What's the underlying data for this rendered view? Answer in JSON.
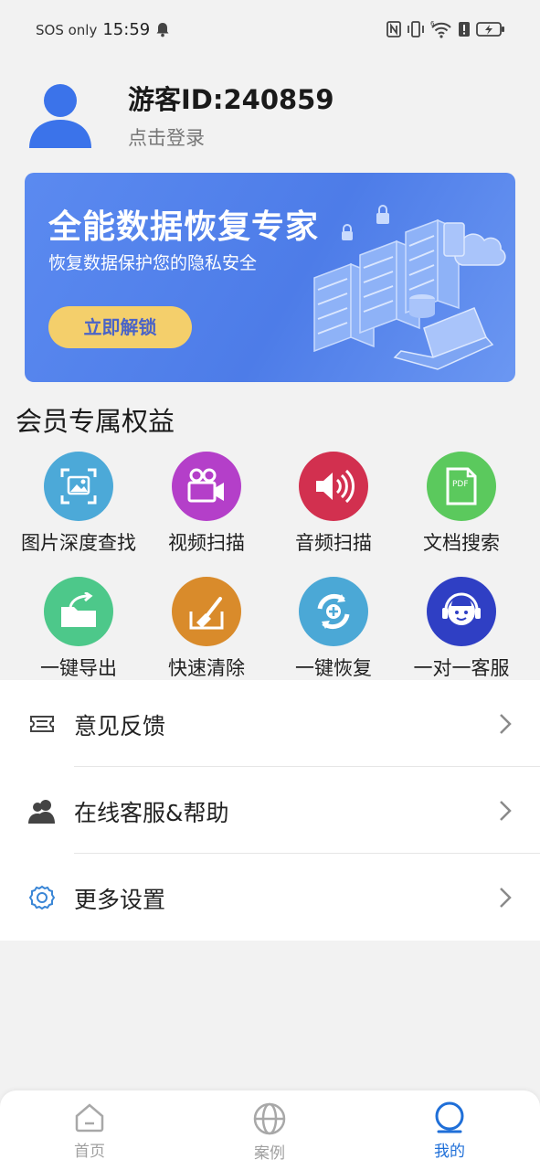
{
  "status_bar": {
    "carrier": "SOS only",
    "time": "15:59",
    "icons": [
      "bell-icon",
      "nfc-icon",
      "vibrate-icon",
      "wifi-icon",
      "alert-icon",
      "battery-charging-icon"
    ],
    "wifi_badge": "6"
  },
  "profile": {
    "user_id": "游客ID:240859",
    "login_text": "点击登录",
    "avatar_color": "#3b73ea"
  },
  "banner": {
    "title": "全能数据恢复专家",
    "subtitle": "恢复数据保护您的隐私安全",
    "button_label": "立即解锁",
    "background_color": "#5282ee",
    "button_color": "#f4cf6b"
  },
  "benefits_section": {
    "title": "会员专属权益",
    "items": [
      {
        "label": "图片深度查找",
        "icon": "image-search-icon",
        "color": "#4ca9d8"
      },
      {
        "label": "视频扫描",
        "icon": "video-camera-icon",
        "color": "#b43fc9"
      },
      {
        "label": "音频扫描",
        "icon": "speaker-icon",
        "color": "#d2304f"
      },
      {
        "label": "文档搜索",
        "icon": "pdf-document-icon",
        "color": "#5bc95d"
      },
      {
        "label": "一键导出",
        "icon": "folder-export-icon",
        "color": "#4dc88a"
      },
      {
        "label": "快速清除",
        "icon": "broom-clean-icon",
        "color": "#d98b2b"
      },
      {
        "label": "一键恢复",
        "icon": "restore-cycle-icon",
        "color": "#4ba8d6"
      },
      {
        "label": "一对一客服",
        "icon": "customer-service-icon",
        "color": "#2f3fc4"
      }
    ]
  },
  "menu": {
    "items": [
      {
        "label": "意见反馈",
        "icon": "ticket-feedback-icon"
      },
      {
        "label": "在线客服&帮助",
        "icon": "users-icon"
      },
      {
        "label": "更多设置",
        "icon": "gear-icon"
      }
    ]
  },
  "bottom_nav": {
    "items": [
      {
        "label": "首页",
        "icon": "home-icon",
        "active": false
      },
      {
        "label": "案例",
        "icon": "globe-icon",
        "active": false
      },
      {
        "label": "我的",
        "icon": "profile-circle-icon",
        "active": true
      }
    ],
    "active_color": "#1f6fd8",
    "inactive_color": "#a0a0a0"
  }
}
